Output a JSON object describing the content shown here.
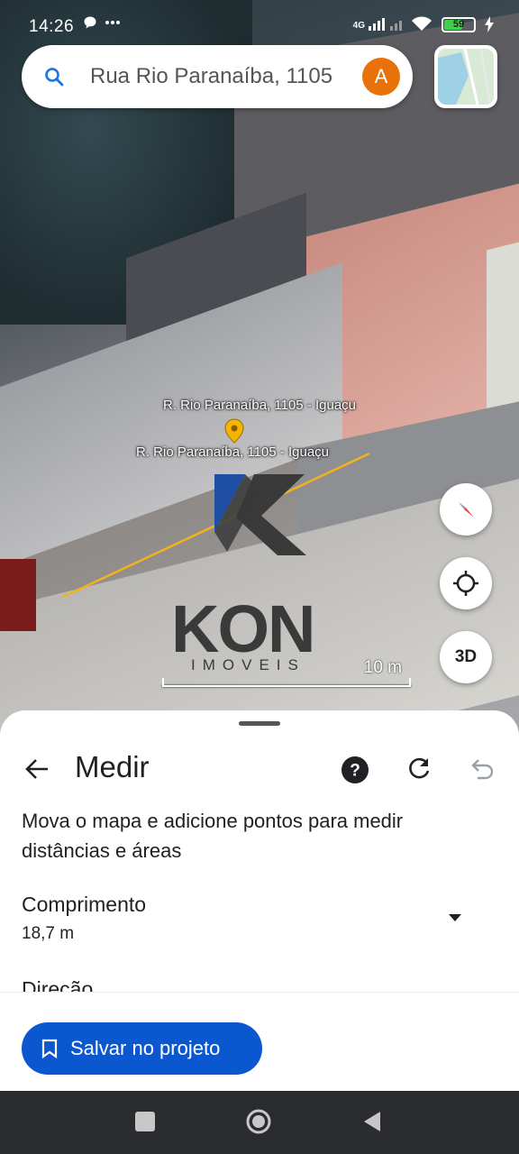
{
  "status_bar": {
    "time": "14:26",
    "network": "4G",
    "battery": "59"
  },
  "search": {
    "query": "Rua Rio Paranaíba, 1105",
    "avatar_letter": "A"
  },
  "map": {
    "place_label_1": "R. Rio Paranaíba, 1105 - Iguaçu",
    "place_label_2": "R. Rio Paranaíba, 1105 - Iguaçu",
    "watermark_word": "KON",
    "watermark_sub": "IMOVEIS",
    "scale_label": "10 m",
    "button_3d": "3D"
  },
  "sheet": {
    "title": "Medir",
    "description": "Mova o mapa e adicione pontos para medir distâncias e áreas",
    "length_label": "Comprimento",
    "length_value": "18,7 m",
    "direction_label": "Direção",
    "save_button": "Salvar no projeto"
  },
  "colors": {
    "accent": "#0b57d0",
    "avatar": "#e8710a",
    "measure_line": "#f2b21c"
  },
  "icons": [
    "search-icon",
    "chat-icon",
    "more-icon",
    "signal-icon",
    "wifi-icon",
    "battery-icon",
    "charging-icon",
    "compass-icon",
    "my-location-icon",
    "back-arrow-icon",
    "help-icon",
    "refresh-icon",
    "undo-icon",
    "dropdown-arrow-icon",
    "bookmark-icon"
  ]
}
